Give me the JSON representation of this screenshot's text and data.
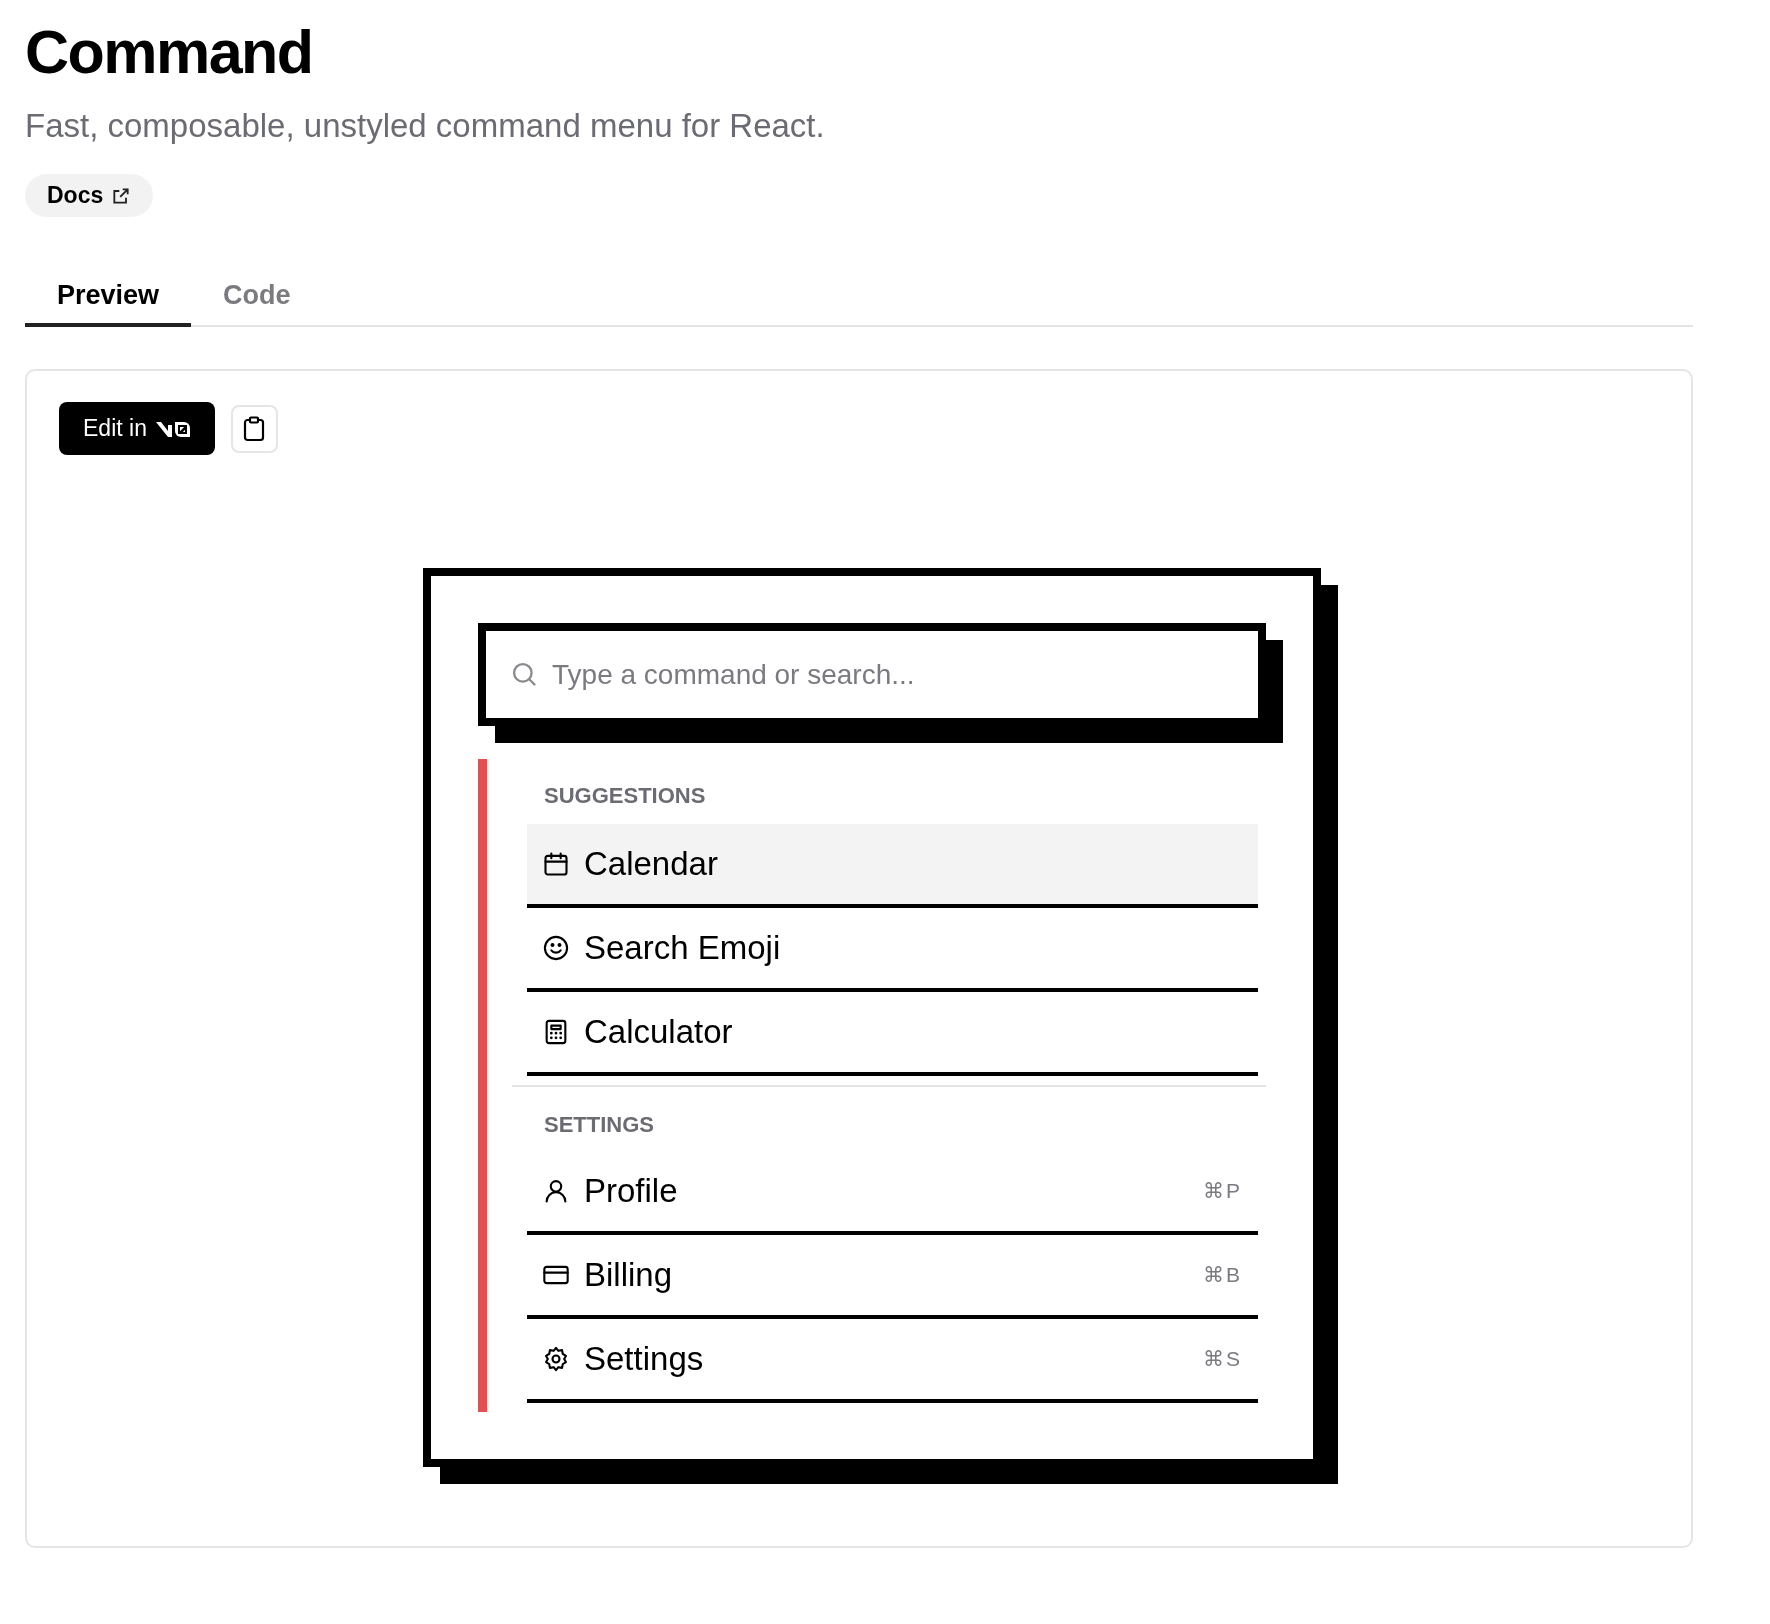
{
  "page": {
    "title": "Command",
    "subtitle": "Fast, composable, unstyled command menu for React."
  },
  "docs_link": {
    "label": "Docs"
  },
  "tabs": [
    {
      "label": "Preview",
      "selected": true
    },
    {
      "label": "Code",
      "selected": false
    }
  ],
  "preview": {
    "edit_button": {
      "label": "Edit in"
    },
    "command": {
      "placeholder": "Type a command or search...",
      "groups": [
        {
          "heading": "SUGGESTIONS",
          "items": [
            {
              "kind": "calendar",
              "label": "Calendar",
              "selected": true
            },
            {
              "kind": "emoji",
              "label": "Search Emoji",
              "selected": false
            },
            {
              "kind": "calculator",
              "label": "Calculator",
              "selected": false
            }
          ]
        },
        {
          "heading": "SETTINGS",
          "items": [
            {
              "kind": "profile",
              "label": "Profile",
              "shortcut": "⌘P",
              "selected": false
            },
            {
              "kind": "billing",
              "label": "Billing",
              "shortcut": "⌘B",
              "selected": false
            },
            {
              "kind": "settings",
              "label": "Settings",
              "shortcut": "⌘S",
              "selected": false
            }
          ]
        }
      ]
    }
  }
}
